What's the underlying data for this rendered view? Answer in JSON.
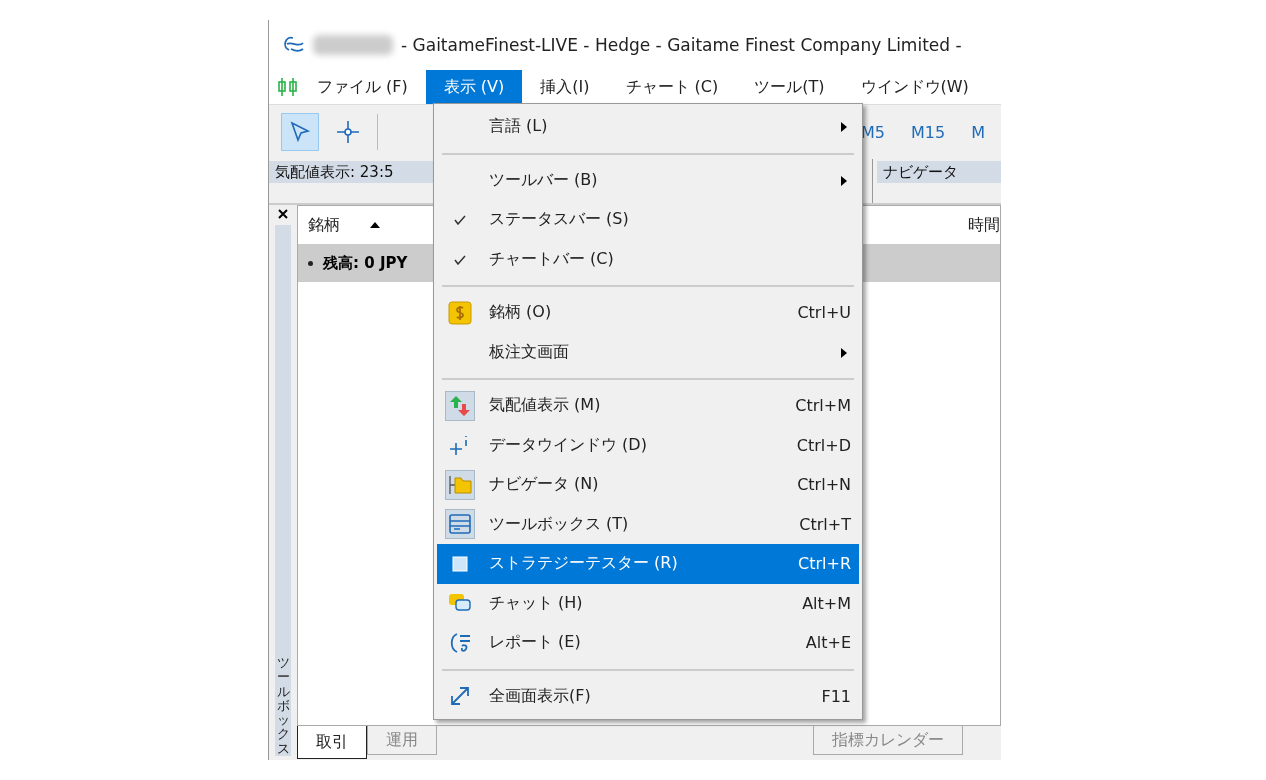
{
  "window": {
    "title": "- GaitameFinest-LIVE - Hedge - Gaitame Finest Company Limited -"
  },
  "menubar": [
    {
      "label": "ファイル (F)",
      "selected": false
    },
    {
      "label": "表示 (V)",
      "selected": true
    },
    {
      "label": "挿入(I)",
      "selected": false
    },
    {
      "label": "チャート (C)",
      "selected": false
    },
    {
      "label": "ツール(T)",
      "selected": false
    },
    {
      "label": "ウインドウ(W)",
      "selected": false
    }
  ],
  "toolbar": {
    "tools": [
      {
        "selected": true
      },
      {
        "selected": false
      }
    ],
    "timeframes": [
      "M5",
      "M15",
      "M"
    ]
  },
  "panels": {
    "market_watch": "気配値表示: 23:5",
    "navigator": "ナビゲータ"
  },
  "toolbox": {
    "side_label": "ツールボックス",
    "columns": [
      "銘柄",
      "時間"
    ],
    "balance_row": "残高: 0 JPY",
    "tabs": [
      {
        "label": "取引",
        "selected": true
      },
      {
        "label": "運用",
        "selected": false
      },
      {
        "label": "指標カレンダー",
        "selected": false
      }
    ]
  },
  "menu": [
    {
      "kind": "item",
      "label": "言語 (L)",
      "submenu": true,
      "checked": false
    },
    {
      "kind": "separator"
    },
    {
      "kind": "item",
      "label": "ツールバー (B)",
      "submenu": true,
      "checked": false
    },
    {
      "kind": "item",
      "label": "ステータスバー (S)",
      "checked": true
    },
    {
      "kind": "item",
      "label": "チャートバー (C)",
      "checked": true
    },
    {
      "kind": "separator"
    },
    {
      "kind": "item",
      "label": "銘柄 (O)",
      "shortcut": "Ctrl+U"
    },
    {
      "kind": "item",
      "label": "板注文画面",
      "submenu": true
    },
    {
      "kind": "separator"
    },
    {
      "kind": "item",
      "label": "気配値表示 (M)",
      "on": true,
      "shortcut": "Ctrl+M"
    },
    {
      "kind": "item",
      "label": "データウインドウ (D)",
      "on": false,
      "shortcut": "Ctrl+D"
    },
    {
      "kind": "item",
      "label": "ナビゲータ (N)",
      "on": true,
      "shortcut": "Ctrl+N"
    },
    {
      "kind": "item",
      "label": "ツールボックス (T)",
      "on": true,
      "shortcut": "Ctrl+T"
    },
    {
      "kind": "item",
      "label": "ストラテジーテスター (R)",
      "on": false,
      "selected": true,
      "shortcut": "Ctrl+R"
    },
    {
      "kind": "item",
      "label": "チャット (H)",
      "shortcut": "Alt+M"
    },
    {
      "kind": "item",
      "label": "レポート (E)",
      "shortcut": "Alt+E"
    },
    {
      "kind": "separator"
    },
    {
      "kind": "item",
      "label": "全画面表示(F)",
      "shortcut": "F11"
    }
  ]
}
